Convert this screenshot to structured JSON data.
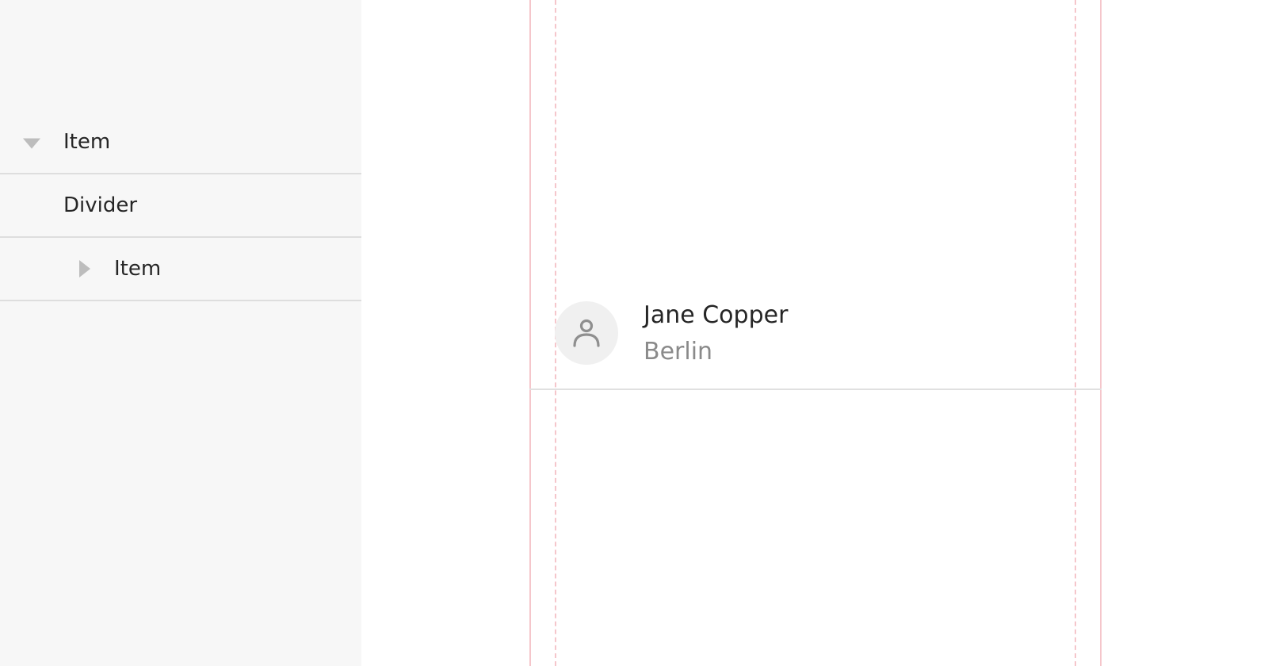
{
  "sidebar": {
    "items": [
      {
        "label": "Item",
        "icon": "caret-down-icon"
      },
      {
        "label": "Divider"
      },
      {
        "label": "Item",
        "icon": "caret-right-icon"
      }
    ]
  },
  "list_item": {
    "primary": "Jane Copper",
    "secondary": "Berlin",
    "avatar_icon": "user-icon"
  },
  "colors": {
    "sidebar_bg": "#f7f7f7",
    "guide_line": "#f5c6cb",
    "divider": "#dedede",
    "avatar_bg": "#f0f0f0"
  }
}
